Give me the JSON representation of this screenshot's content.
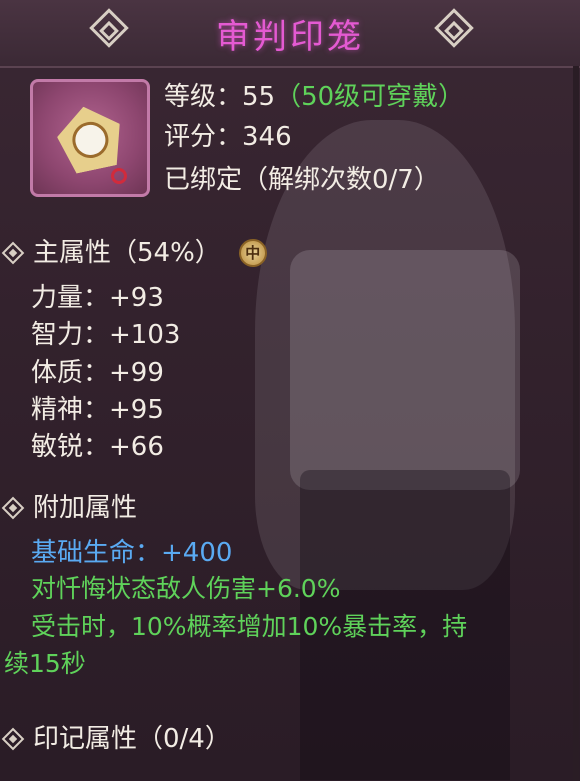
{
  "title": "审判印笼",
  "item": {
    "icon": "amulet-icon",
    "level_prefix": "等级：55",
    "level_note": "（50级可穿戴）",
    "score": "评分：346",
    "bound": "已绑定（解绑次数0/7）"
  },
  "main_attr": {
    "title": "主属性（54%）",
    "medal": "中",
    "items": [
      "力量：+93",
      "智力：+103",
      "体质：+99",
      "精神：+95",
      "敏锐：+66"
    ]
  },
  "extra_attr": {
    "title": "附加属性",
    "base_hp": "基础生命：+400",
    "line1": "对忏悔状态敌人伤害+6.0%",
    "line2": "受击时，10%概率增加10%暴击率，持",
    "line3": "续15秒"
  },
  "mark_attr": {
    "title": "印记属性（0/4）"
  },
  "colors": {
    "title": "#e45ad2",
    "green": "#5fd25a",
    "blue": "#5aaaf2",
    "text": "#f2ece4"
  }
}
